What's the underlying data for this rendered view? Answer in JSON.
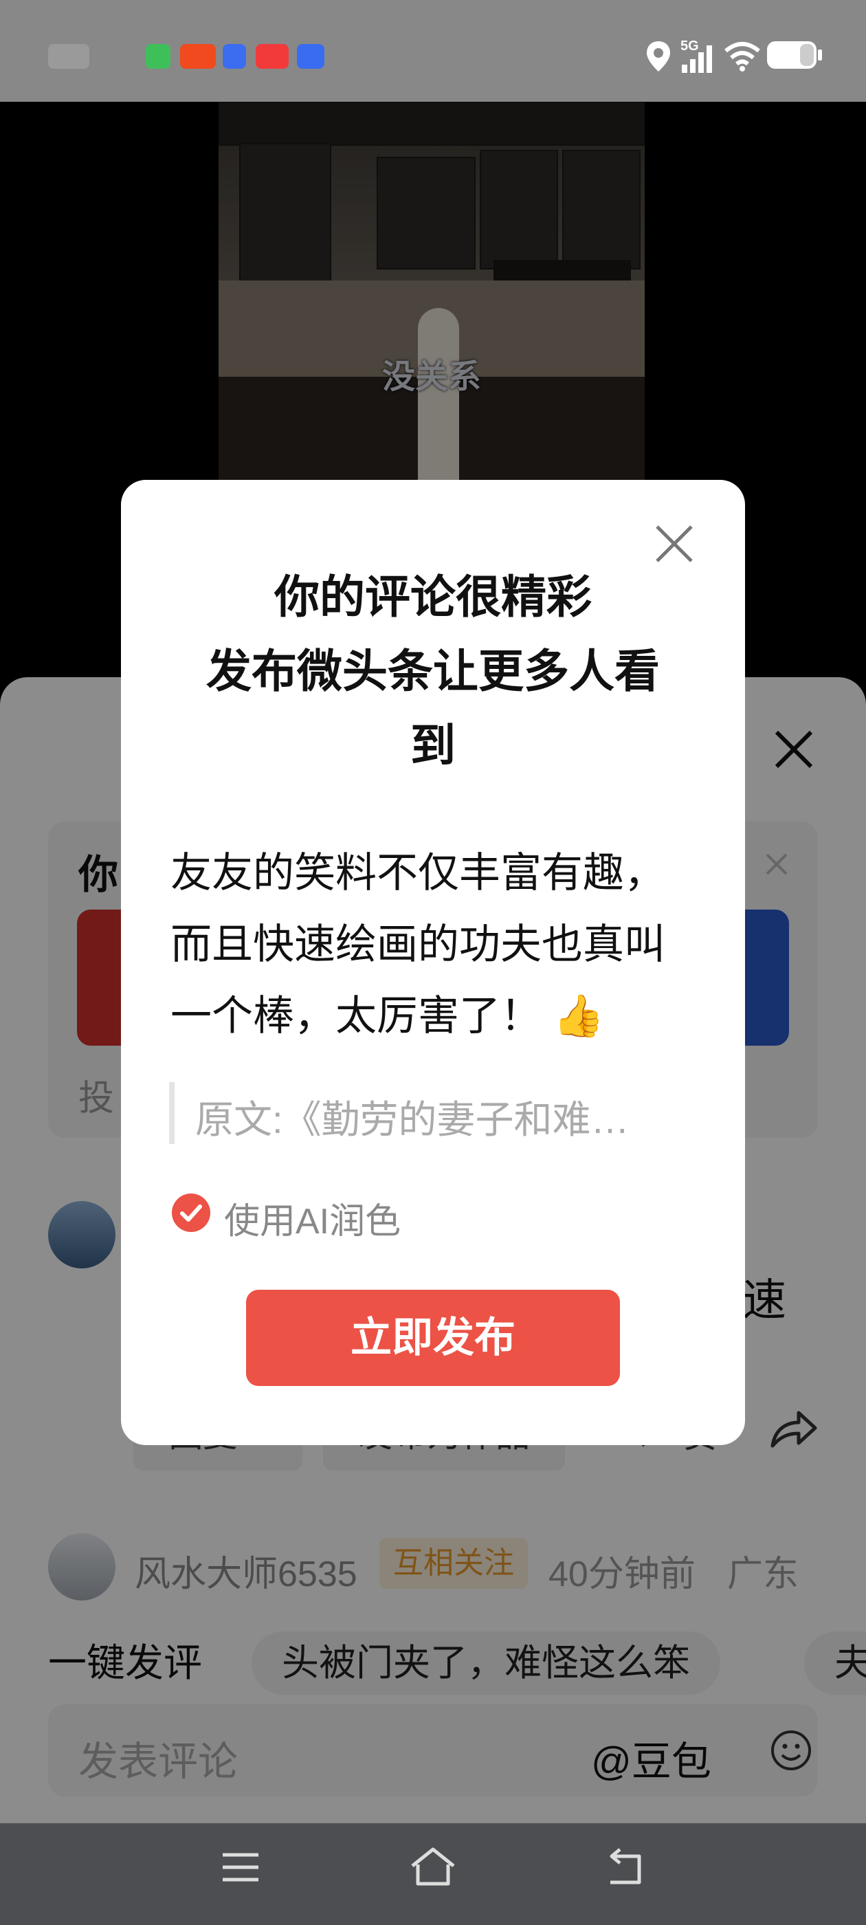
{
  "status_bar": {
    "network": "5G",
    "icons": [
      "location-icon",
      "signal-icon",
      "wifi-icon",
      "battery-icon"
    ]
  },
  "video": {
    "subtitle": "没关系"
  },
  "sheet": {
    "promo_title_partial": "你",
    "promo_sub_partial": "投",
    "comment_tail": "速",
    "reply_button": "回复 >",
    "publish_as_work_button": "发布为作品",
    "like_label": "赞",
    "second_comment": {
      "username": "风水大师6535",
      "badge": "互相关注",
      "time": "40分钟前",
      "location": "广东"
    },
    "quick_comment_label": "一键发评",
    "quick_comment_chips": [
      "头被门夹了，难怪这么笨",
      "夫"
    ],
    "input_placeholder": "发表评论",
    "mention_label": "@豆包"
  },
  "dialog": {
    "title": "你的评论很精彩\n发布微头条让更多人看\n到",
    "body": "友友的笑料不仅丰富有趣，而且快速绘画的功夫也真叫一个棒，太厉害了！",
    "emoji": "👍",
    "quote": "原文:《勤劳的妻子和难…",
    "ai_polish_label": "使用AI润色",
    "ai_polish_checked": true,
    "publish_button": "立即发布"
  },
  "colors": {
    "accent_red": "#ec5246",
    "badge_bg": "#fdf0dc",
    "badge_text": "#e79a2c"
  }
}
